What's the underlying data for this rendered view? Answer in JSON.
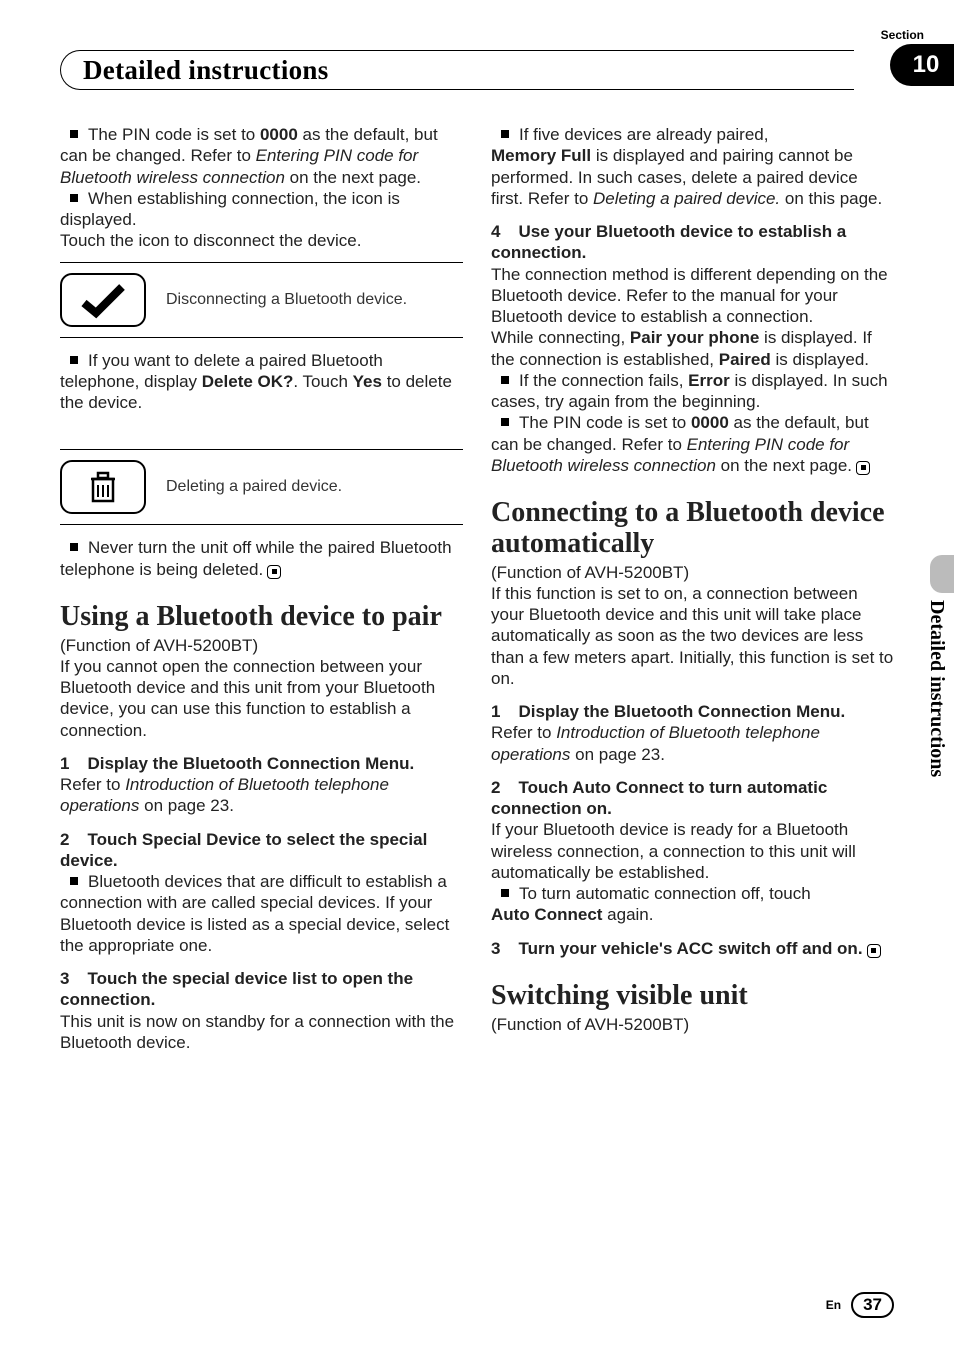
{
  "meta": {
    "section_label": "Section",
    "chapter_number": "10",
    "chapter_title": "Detailed instructions",
    "side_label": "Detailed instructions",
    "lang": "En",
    "page_number": "37"
  },
  "col1": {
    "p1a": "The PIN code is set to ",
    "p1b": "0000",
    "p1c": " as the default, but can be changed. Refer to ",
    "p1d": "Entering PIN code for Bluetooth wireless connection",
    "p1e": " on the next page.",
    "p2": "When establishing connection, the icon is displayed.",
    "p3": "Touch the icon to disconnect the device.",
    "icon1_caption": "Disconnecting a Bluetooth device.",
    "p4a": "If you want to delete a paired Bluetooth telephone, display ",
    "p4b": "Delete OK?",
    "p4c": ". Touch ",
    "p4d": "Yes",
    "p4e": " to delete the device.",
    "icon2_caption": "Deleting a paired device.",
    "p5": "Never turn the unit off while the paired Bluetooth telephone is being deleted.",
    "h_using": "Using a Bluetooth device to pair",
    "func": "(Function of AVH-5200BT)",
    "p6": "If you cannot open the connection between your Bluetooth device and this unit from your Bluetooth device, you can use this function to establish a connection.",
    "s1_num": "1",
    "s1_title": "Display the Bluetooth Connection Menu.",
    "s1_body_a": "Refer to ",
    "s1_body_b": "Introduction of Bluetooth telephone operations",
    "s1_body_c": " on page 23.",
    "s2_num": "2",
    "s2_title": "Touch Special Device to select the special device.",
    "s2_body": "Bluetooth devices that are difficult to establish a connection with are called special devices. If your Bluetooth device is listed as a special device, select the appropriate one.",
    "s3_num": "3",
    "s3_title": "Touch the special device list to open the connection.",
    "s3_body1": "This unit is now on standby for a connection with the Bluetooth device.",
    "s3_body2a": "If five devices are already paired, ",
    "s3_body2b": "Memory Full",
    "s3_body2c": " is displayed and pairing cannot be performed. In such cases, delete a paired device"
  },
  "col2": {
    "cont_a": "first. Refer to ",
    "cont_b": "Deleting a paired device.",
    "cont_c": " on this page.",
    "s4_num": "4",
    "s4_title": "Use your Bluetooth device to establish a connection.",
    "s4_body1": "The connection method is different depending on the Bluetooth device. Refer to the manual for your Bluetooth device to establish a connection.",
    "s4_body2a": "While connecting, ",
    "s4_body2b": "Pair your phone",
    "s4_body2c": " is displayed. If the connection is established, ",
    "s4_body2d": "Paired",
    "s4_body2e": " is displayed.",
    "s4_body3a": "If the connection fails, ",
    "s4_body3b": "Error",
    "s4_body3c": " is displayed. In such cases, try again from the beginning.",
    "s4_body4a": "The PIN code is set to ",
    "s4_body4b": "0000",
    "s4_body4c": " as the default, but can be changed. Refer to ",
    "s4_body4d": "Entering PIN code for Bluetooth wireless connection",
    "s4_body4e": " on the next page.",
    "h_connect": "Connecting to a Bluetooth device automatically",
    "func2": "(Function of AVH-5200BT)",
    "p7": "If this function is set to on, a connection between your Bluetooth device and this unit will take place automatically as soon as the two devices are less than a few meters apart. Initially, this function is set to on.",
    "c1_num": "1",
    "c1_title": "Display the Bluetooth Connection Menu.",
    "c1_body_a": "Refer to ",
    "c1_body_b": "Introduction of Bluetooth telephone operations",
    "c1_body_c": " on page 23.",
    "c2_num": "2",
    "c2_title": "Touch Auto Connect to turn automatic connection on.",
    "c2_body": "If your Bluetooth device is ready for a Bluetooth wireless connection, a connection to this unit will automatically be established.",
    "c2_body2a": "To turn automatic connection off, touch ",
    "c2_body2b": "Auto Connect",
    "c2_body2c": " again.",
    "c3_num": "3",
    "c3_title": "Turn your vehicle's ACC switch off and on.",
    "h_switch": "Switching visible unit",
    "func3": "(Function of AVH-5200BT)"
  }
}
